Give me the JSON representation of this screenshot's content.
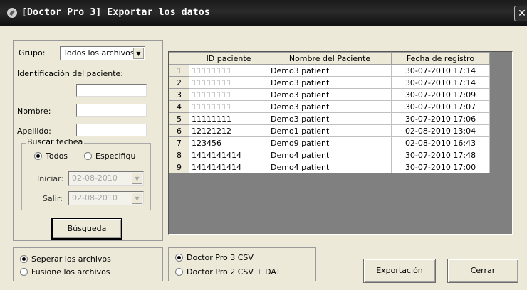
{
  "window": {
    "title": "[Doctor Pro 3] Exportar los datos",
    "close_glyph": "✕"
  },
  "search": {
    "group_label": "Grupo:",
    "group_value": "Todos los archivos",
    "patient_id_label": "Identificación del paciente:",
    "patient_id_value": "",
    "name_label": "Nombre:",
    "name_value": "",
    "surname_label": "Apellido:",
    "surname_value": "",
    "date_group_label": "Buscar fechea",
    "date_all_label": "Todos",
    "date_specify_label": "Especifiqu",
    "date_all_checked": true,
    "start_label": "Iniciar:",
    "start_value": "02-08-2010",
    "end_label": "Salir:",
    "end_value": "02-08-2010",
    "search_button": "Búsqueda",
    "search_button_mnemonic": "B"
  },
  "grid": {
    "columns": [
      "",
      "ID paciente",
      "Nombre del Paciente",
      "Fecha de registro"
    ],
    "rows": [
      {
        "n": "1",
        "id": "11111111",
        "name": "Demo3 patient",
        "date": "30-07-2010 17:14"
      },
      {
        "n": "2",
        "id": "11111111",
        "name": "Demo3 patient",
        "date": "30-07-2010 17:14"
      },
      {
        "n": "3",
        "id": "11111111",
        "name": "Demo3 patient",
        "date": "30-07-2010 17:09"
      },
      {
        "n": "4",
        "id": "11111111",
        "name": "Demo3 patient",
        "date": "30-07-2010 17:07"
      },
      {
        "n": "5",
        "id": "11111111",
        "name": "Demo3 patient",
        "date": "30-07-2010 17:06"
      },
      {
        "n": "6",
        "id": "12121212",
        "name": "Demo1 patient",
        "date": "02-08-2010 13:04"
      },
      {
        "n": "7",
        "id": "123456",
        "name": "Demo9 patient",
        "date": "02-08-2010 16:43"
      },
      {
        "n": "8",
        "id": "1414141414",
        "name": "Demo4 patient",
        "date": "30-07-2010 17:48"
      },
      {
        "n": "9",
        "id": "1414141414",
        "name": "Demo4 patient",
        "date": "30-07-2010 17:00"
      }
    ]
  },
  "file_options": {
    "separate_label": "Seperar los archivos",
    "merge_label": "Fusione los archivos",
    "separate_checked": true
  },
  "format_options": {
    "csv3_label": "Doctor Pro 3 CSV",
    "csv2_label": "Doctor Pro 2 CSV + DAT",
    "csv3_checked": true
  },
  "actions": {
    "export_button": "Exportación",
    "export_mnemonic": "E",
    "close_button": "Cerrar",
    "close_mnemonic": "C"
  },
  "colors": {
    "titlebar": "#1b1b1b",
    "dialog_bg": "#ece9d8",
    "grid_bg": "#808080"
  },
  "icons": {
    "title": "app-icon",
    "combo_arrow": "▼"
  }
}
